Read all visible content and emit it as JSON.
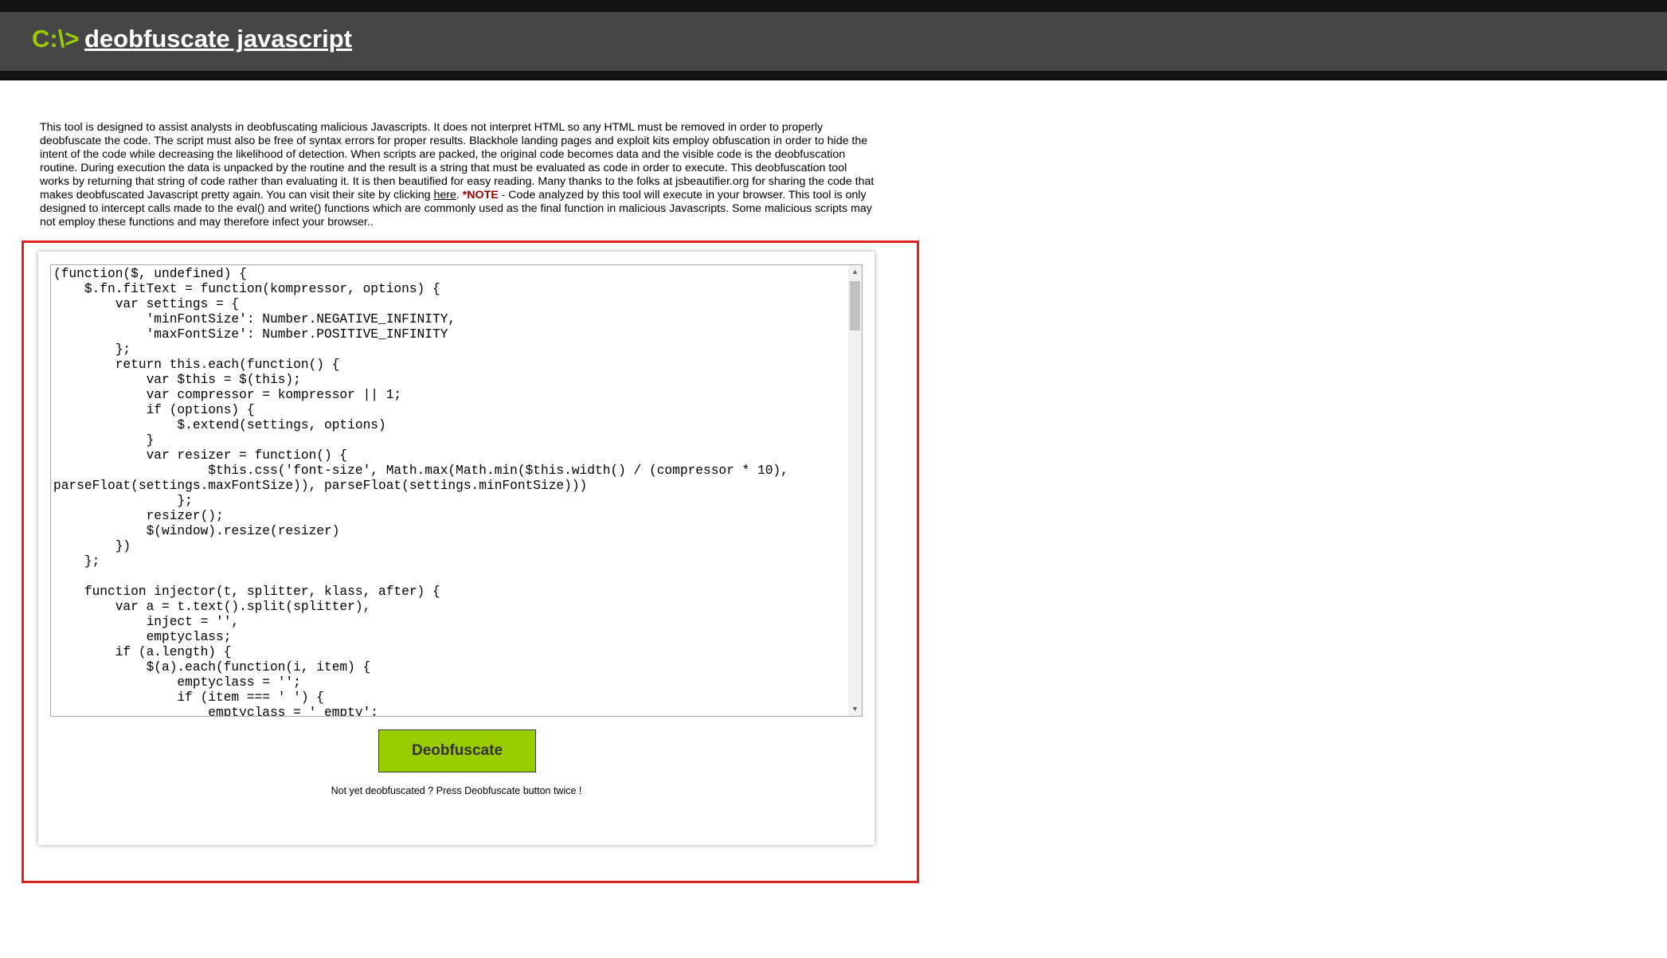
{
  "header": {
    "prompt": "C:\\>",
    "title": "deobfuscate javascript"
  },
  "intro": {
    "text_before_link": "This tool is designed to assist analysts in deobfuscating malicious Javascripts. It does not interpret HTML so any HTML must be removed in order to properly deobfuscate the code. The script must also be free of syntax errors for proper results. Blackhole landing pages and exploit kits employ obfuscation in order to hide the intent of the code while decreasing the likelihood of detection. When scripts are packed, the original code becomes data and the visible code is the deobfuscation routine. During execution the data is unpacked by the routine and the result is a string that must be evaluated as code in order to execute. This deobfuscation tool works by returning that string of code rather than evaluating it. It is then beautified for easy reading. Many thanks to the folks at jsbeautifier.org for sharing the code that makes deobfuscated Javascript pretty again. You can visit their site by clicking ",
    "link_text": "here",
    "after_link": ". ",
    "note_label": "*NOTE",
    "note_text": " - Code analyzed by this tool will execute in your browser. This tool is only designed to intercept calls made to the eval() and write() functions which are commonly used as the final function in malicious Javascripts. Some malicious scripts may not employ these functions and may therefore infect your browser.."
  },
  "editor": {
    "code": "(function($, undefined) {\n    $.fn.fitText = function(kompressor, options) {\n        var settings = {\n            'minFontSize': Number.NEGATIVE_INFINITY,\n            'maxFontSize': Number.POSITIVE_INFINITY\n        };\n        return this.each(function() {\n            var $this = $(this);\n            var compressor = kompressor || 1;\n            if (options) {\n                $.extend(settings, options)\n            }\n            var resizer = function() {\n                    $this.css('font-size', Math.max(Math.min($this.width() / (compressor * 10),\nparseFloat(settings.maxFontSize)), parseFloat(settings.minFontSize)))\n                };\n            resizer();\n            $(window).resize(resizer)\n        })\n    };\n\n    function injector(t, splitter, klass, after) {\n        var a = t.text().split(splitter),\n            inject = '',\n            emptyclass;\n        if (a.length) {\n            $(a).each(function(i, item) {\n                emptyclass = '';\n                if (item === ' ') {\n                    emptyclass = ' empty';"
  },
  "actions": {
    "deobfuscate_label": "Deobfuscate",
    "hint": "Not yet deobfuscated ? Press Deobfuscate button twice !"
  },
  "colors": {
    "accent": "#99cc00",
    "header_bg": "#464646",
    "highlight": "#dd2222",
    "note": "#990000"
  }
}
